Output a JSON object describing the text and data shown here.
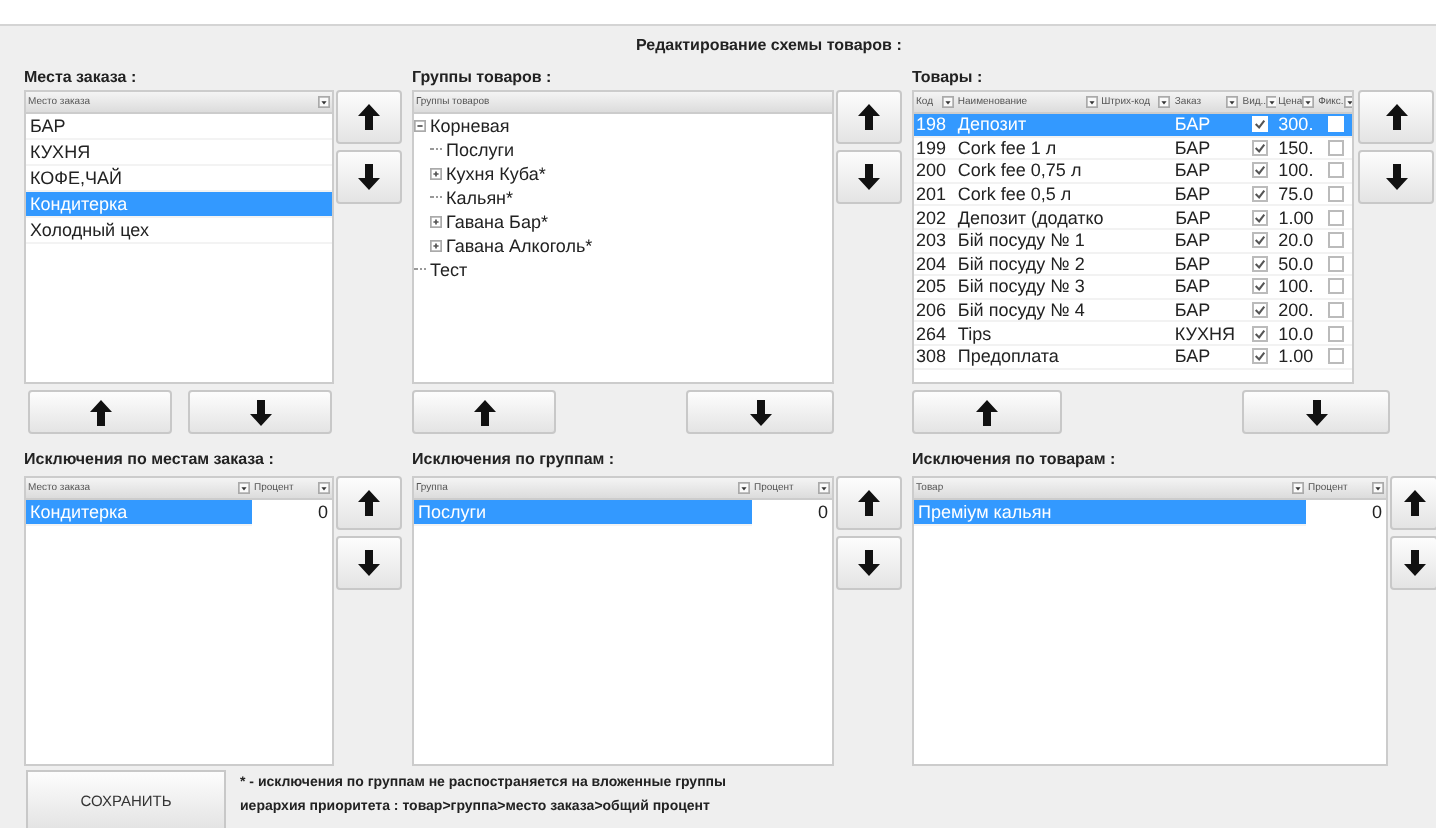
{
  "title": "Редактирование схемы товаров :",
  "places": {
    "label": "Места заказа :",
    "column": "Место заказа",
    "items": [
      {
        "text": "БАР",
        "selected": false
      },
      {
        "text": "КУХНЯ",
        "selected": false
      },
      {
        "text": "КОФЕ,ЧАЙ",
        "selected": false
      },
      {
        "text": "Кондитерка",
        "selected": true
      },
      {
        "text": "Холодный цех",
        "selected": false
      }
    ]
  },
  "groups": {
    "label": "Группы товаров :",
    "column": "Группы товаров",
    "tree": [
      {
        "text": "Корневая",
        "expanded": true,
        "children": [
          {
            "text": "Послуги"
          },
          {
            "text": "Кухня Куба*",
            "expanded": false
          },
          {
            "text": "Кальян*"
          },
          {
            "text": "Гавана Бар*",
            "expanded": false
          },
          {
            "text": "Гавана Алкоголь*",
            "expanded": false
          }
        ]
      },
      {
        "text": "Тест"
      }
    ]
  },
  "products": {
    "label": "Товары :",
    "columns": [
      "Код",
      "Наименование",
      "Штрих-код",
      "Заказ",
      "Вид..",
      "Цена",
      "Фикс."
    ],
    "rows": [
      {
        "code": "198",
        "name": "Депозит",
        "place": "БАР",
        "visible": true,
        "price": "300.",
        "fixed": false,
        "selected": true
      },
      {
        "code": "199",
        "name": "Cork fee 1 л",
        "place": "БАР",
        "visible": true,
        "price": "150.",
        "fixed": false,
        "selected": false
      },
      {
        "code": "200",
        "name": "Cork fee 0,75 л",
        "place": "БАР",
        "visible": true,
        "price": "100.",
        "fixed": false,
        "selected": false
      },
      {
        "code": "201",
        "name": "Cork fee 0,5 л",
        "place": "БАР",
        "visible": true,
        "price": "75.0",
        "fixed": false,
        "selected": false
      },
      {
        "code": "202",
        "name": "Депозит (додатко",
        "place": "БАР",
        "visible": true,
        "price": "1.00",
        "fixed": false,
        "selected": false
      },
      {
        "code": "203",
        "name": "Бій посуду № 1",
        "place": "БАР",
        "visible": true,
        "price": "20.0",
        "fixed": false,
        "selected": false
      },
      {
        "code": "204",
        "name": "Бій посуду № 2",
        "place": "БАР",
        "visible": true,
        "price": "50.0",
        "fixed": false,
        "selected": false
      },
      {
        "code": "205",
        "name": "Бій посуду № 3",
        "place": "БАР",
        "visible": true,
        "price": "100.",
        "fixed": false,
        "selected": false
      },
      {
        "code": "206",
        "name": "Бій посуду № 4",
        "place": "БАР",
        "visible": true,
        "price": "200.",
        "fixed": false,
        "selected": false
      },
      {
        "code": "264",
        "name": "Tips",
        "place": "КУХНЯ",
        "visible": true,
        "price": "10.0",
        "fixed": false,
        "selected": false
      },
      {
        "code": "308",
        "name": "Предоплата",
        "place": "БАР",
        "visible": true,
        "price": "1.00",
        "fixed": false,
        "selected": false
      }
    ]
  },
  "exceptions": [
    {
      "label": "Исключения по местам заказа :",
      "columns": [
        "Место заказа",
        "Процент"
      ],
      "rows": [
        {
          "name": "Кондитерка",
          "percent": "0",
          "selected": true
        }
      ]
    },
    {
      "label": "Исключения по группам :",
      "columns": [
        "Группа",
        "Процент"
      ],
      "rows": [
        {
          "name": "Послуги",
          "percent": "0",
          "selected": true
        }
      ]
    },
    {
      "label": "Исключения по товарам :",
      "columns": [
        "Товар",
        "Процент"
      ],
      "rows": [
        {
          "name": "Преміум кальян",
          "percent": "0",
          "selected": true
        }
      ]
    }
  ],
  "save_button": "СОХРАНИТЬ",
  "notes": [
    "* - исключения по группам не распостраняется на вложенные группы",
    "иерархия приоритета : товар>группа>место заказа>общий процент"
  ]
}
